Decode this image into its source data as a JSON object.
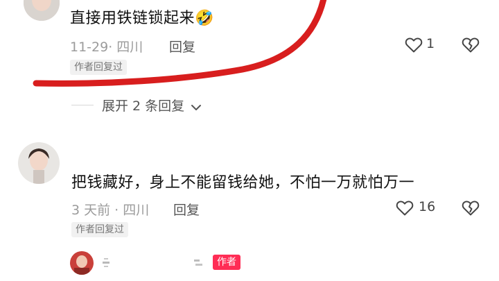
{
  "comments": [
    {
      "text": "直接用铁链锁起来🤣",
      "time_location": "11-29· 四川",
      "reply_label": "回复",
      "badge": "作者回复过",
      "like_count": "1"
    },
    {
      "text": "把钱藏好，身上不能留钱给她，不怕一万就怕万一",
      "time_location": "3 天前 · 四川",
      "reply_label": "回复",
      "badge": "作者回复过",
      "like_count": "16"
    }
  ],
  "expand_label": "展开 2 条回复",
  "reply_preview": {
    "author_tag": "作者"
  },
  "icons": {
    "like": "heart-outline-icon",
    "dislike": "broken-heart-icon",
    "expand": "chevron-down-icon"
  },
  "colors": {
    "annotation_stroke": "#d81e1e",
    "author_tag": "#ff2d55"
  }
}
